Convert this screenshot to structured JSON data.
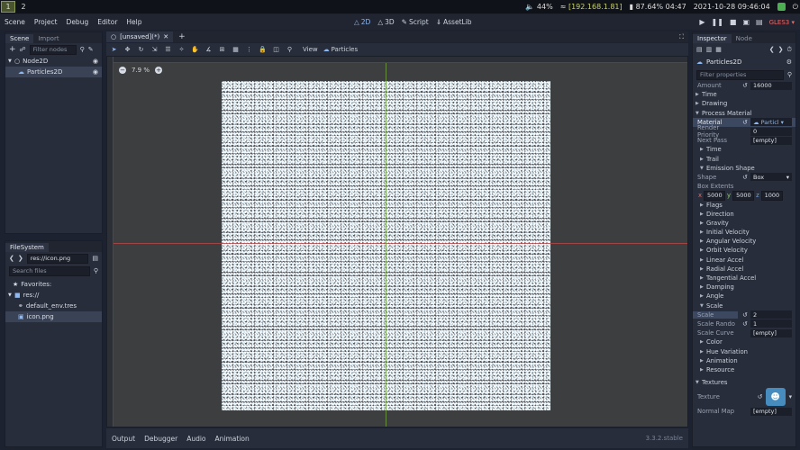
{
  "sysbar": {
    "workspaces": [
      "1",
      "2"
    ],
    "volume": "44%",
    "ip": "[192.168.1.81]",
    "battery": "87.64% 04:47",
    "datetime": "2021-10-28 09:46:04"
  },
  "menubar": {
    "items": [
      "Scene",
      "Project",
      "Debug",
      "Editor",
      "Help"
    ],
    "modes": [
      "2D",
      "3D",
      "Script",
      "AssetLib"
    ],
    "renderer": "GLES3"
  },
  "scene_dock": {
    "tabs": [
      "Scene",
      "Import"
    ],
    "filter_placeholder": "Filter nodes",
    "nodes": [
      "Node2D",
      "Particles2D"
    ]
  },
  "filesystem": {
    "title": "FileSystem",
    "path": "res://icon.png",
    "search_placeholder": "Search files",
    "favorites": "Favorites:",
    "root": "res://",
    "files": [
      "default_env.tres",
      "icon.png"
    ]
  },
  "editor": {
    "tab": "[unsaved](*)",
    "view_menu": "View",
    "particles_menu": "Particles",
    "zoom": "7.9 %"
  },
  "bottom": {
    "tabs": [
      "Output",
      "Debugger",
      "Audio",
      "Animation"
    ],
    "version": "3.3.2.stable"
  },
  "inspector": {
    "tabs": [
      "Inspector",
      "Node"
    ],
    "node": "Particles2D",
    "filter_placeholder": "Filter properties",
    "amount_label": "Amount",
    "amount_value": "16000",
    "time": "Time",
    "drawing": "Drawing",
    "process_material": "Process Material",
    "material_label": "Material",
    "material_value": "Particl",
    "render_priority_label": "Render Priority",
    "render_priority_value": "0",
    "next_pass_label": "Next Pass",
    "next_pass_value": "[empty]",
    "mat_time": "Time",
    "trail": "Trail",
    "emission_shape": "Emission Shape",
    "shape_label": "Shape",
    "shape_value": "Box",
    "box_extents": "Box Extents",
    "box_x": "5000",
    "box_y": "5000",
    "box_z": "1000",
    "groups": [
      "Flags",
      "Direction",
      "Gravity",
      "Initial Velocity",
      "Angular Velocity",
      "Orbit Velocity",
      "Linear Accel",
      "Radial Accel",
      "Tangential Accel",
      "Damping",
      "Angle"
    ],
    "scale": "Scale",
    "scale_label": "Scale",
    "scale_value": "2",
    "scale_random_label": "Scale Rando",
    "scale_random_value": "1",
    "scale_curve_label": "Scale Curve",
    "scale_curve_value": "[empty]",
    "groups2": [
      "Color",
      "Hue Variation",
      "Animation",
      "Resource"
    ],
    "textures": "Textures",
    "texture_label": "Texture",
    "normal_map_label": "Normal Map",
    "normal_map_value": "[empty]"
  }
}
